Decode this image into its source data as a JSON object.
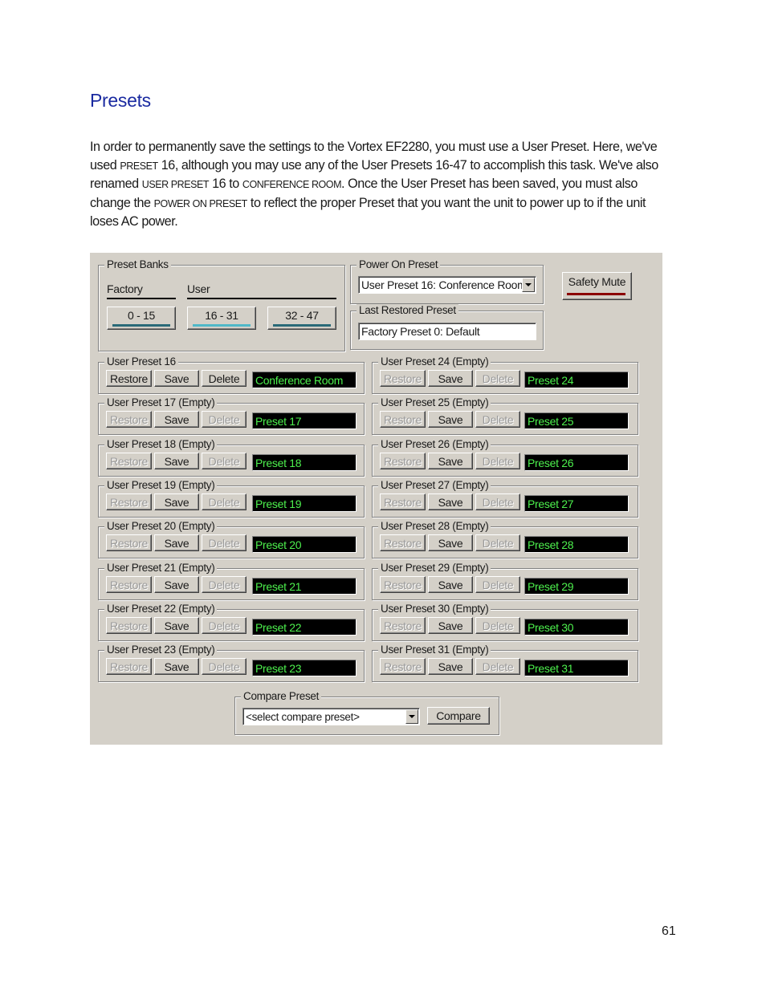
{
  "doc": {
    "heading": "Presets",
    "para": [
      "In order to permanently save the settings to the Vortex EF2280, you must use a User Preset.  Here, we've used ",
      "Preset",
      " 16, although you may use any of the User Presets 16-47 to accomplish this task.  We've also renamed ",
      "User Preset",
      " 16 to ",
      "Conference Room",
      ".  Once the User Preset has been saved, you must also change the ",
      "Power on Preset",
      " to reflect the proper Preset that you want the unit to power up to if the unit loses AC power."
    ],
    "page_number": "61"
  },
  "dialog": {
    "preset_banks": {
      "title": "Preset Banks",
      "factory_label": "Factory",
      "user_label": "User",
      "buttons": [
        "0 - 15",
        "16 - 31",
        "32 - 47"
      ]
    },
    "power_on": {
      "title": "Power On Preset",
      "value": "User Preset 16: Conference Room"
    },
    "last_restored": {
      "title": "Last Restored Preset",
      "value": "Factory Preset 0: Default"
    },
    "safety_mute": "Safety Mute",
    "button_labels": {
      "restore": "Restore",
      "save": "Save",
      "delete": "Delete"
    },
    "left_presets": [
      {
        "title": "User Preset 16",
        "name": "Conference Room",
        "enabled": true
      },
      {
        "title": "User Preset 17 (Empty)",
        "name": "Preset 17",
        "enabled": false
      },
      {
        "title": "User Preset 18 (Empty)",
        "name": "Preset 18",
        "enabled": false
      },
      {
        "title": "User Preset 19 (Empty)",
        "name": "Preset 19",
        "enabled": false
      },
      {
        "title": "User Preset 20 (Empty)",
        "name": "Preset 20",
        "enabled": false
      },
      {
        "title": "User Preset 21 (Empty)",
        "name": "Preset 21",
        "enabled": false
      },
      {
        "title": "User Preset 22 (Empty)",
        "name": "Preset 22",
        "enabled": false
      },
      {
        "title": "User Preset 23 (Empty)",
        "name": "Preset 23",
        "enabled": false
      }
    ],
    "right_presets": [
      {
        "title": "User Preset 24 (Empty)",
        "name": "Preset 24",
        "enabled": false
      },
      {
        "title": "User Preset 25 (Empty)",
        "name": "Preset 25",
        "enabled": false
      },
      {
        "title": "User Preset 26 (Empty)",
        "name": "Preset 26",
        "enabled": false
      },
      {
        "title": "User Preset 27 (Empty)",
        "name": "Preset 27",
        "enabled": false
      },
      {
        "title": "User Preset 28 (Empty)",
        "name": "Preset 28",
        "enabled": false
      },
      {
        "title": "User Preset 29 (Empty)",
        "name": "Preset 29",
        "enabled": false
      },
      {
        "title": "User Preset 30 (Empty)",
        "name": "Preset 30",
        "enabled": false
      },
      {
        "title": "User Preset 31 (Empty)",
        "name": "Preset 31",
        "enabled": false
      }
    ],
    "compare": {
      "title": "Compare Preset",
      "select_value": "<select compare preset>",
      "button": "Compare"
    },
    "colors": {
      "panel": "#d4d0c8",
      "display_text": "#4df04d",
      "display_bg": "#000000",
      "selected_bank_bar": "#4fb8c8",
      "safety_mute_bar": "#8b0000"
    }
  }
}
